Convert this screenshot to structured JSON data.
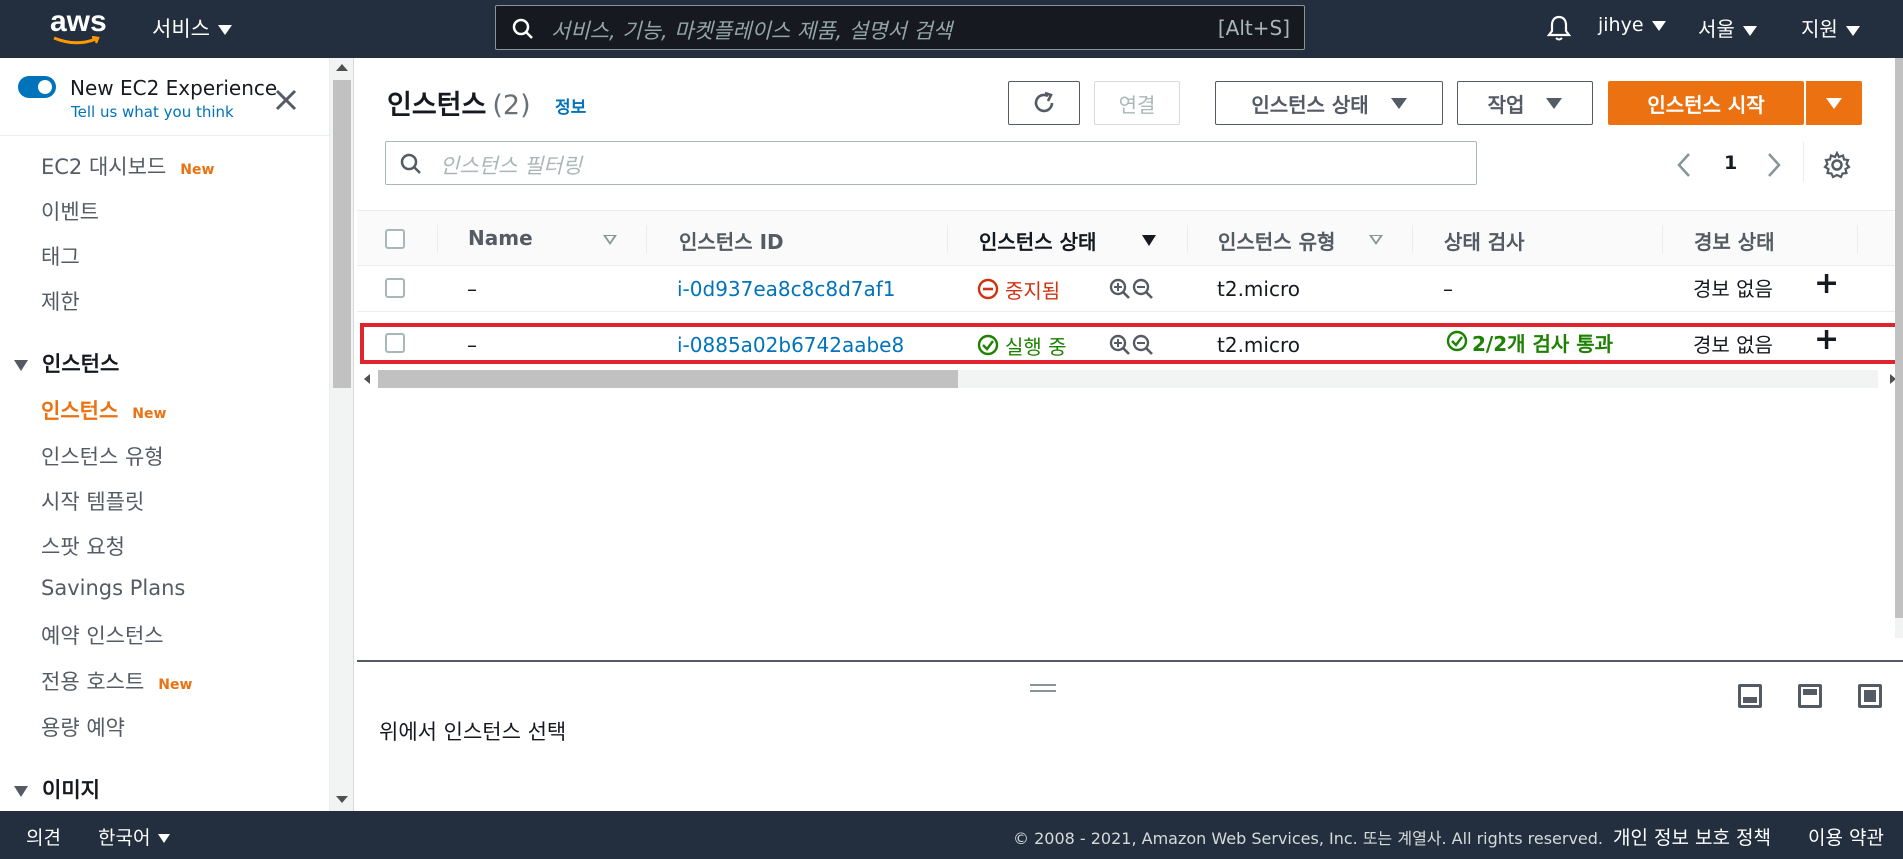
{
  "topbar": {
    "logo_text": "aws",
    "services_label": "서비스",
    "search_placeholder": "서비스, 기능, 마켓플레이스 제품, 설명서 검색",
    "search_shortcut": "[Alt+S]",
    "user": "jihye",
    "region": "서울",
    "support": "지원"
  },
  "sidebar": {
    "new_experience_label": "New EC2 Experience",
    "tell_us": "Tell us what you think",
    "items": [
      {
        "label": "EC2 대시보드",
        "badge": "New"
      },
      {
        "label": "이벤트"
      },
      {
        "label": "태그"
      },
      {
        "label": "제한"
      }
    ],
    "section_instances": "인스턴스",
    "instance_items": [
      {
        "label": "인스턴스",
        "badge": "New",
        "active": true
      },
      {
        "label": "인스턴스 유형"
      },
      {
        "label": "시작 템플릿"
      },
      {
        "label": "스팟 요청"
      },
      {
        "label": "Savings Plans"
      },
      {
        "label": "예약 인스턴스"
      },
      {
        "label": "전용 호스트",
        "badge": "New"
      },
      {
        "label": "용량 예약"
      }
    ],
    "section_images": "이미지"
  },
  "main": {
    "title": "인스턴스",
    "count": "(2)",
    "info_link": "정보",
    "buttons": {
      "connect": "연결",
      "instance_state": "인스턴스 상태",
      "actions": "작업",
      "launch": "인스턴스 시작"
    },
    "filter_placeholder": "인스턴스 필터링",
    "page": "1",
    "columns": [
      "Name",
      "인스턴스 ID",
      "인스턴스 상태",
      "인스턴스 유형",
      "상태 검사",
      "경보 상태"
    ],
    "rows": [
      {
        "name": "–",
        "instance_id": "i-0d937ea8c8c8d7af1",
        "state": "중지됨",
        "state_kind": "stopped",
        "type": "t2.micro",
        "status_check": "–",
        "alarm": "경보 없음",
        "selected": false
      },
      {
        "name": "–",
        "instance_id": "i-0885a02b6742aabe8",
        "state": "실행 중",
        "state_kind": "running",
        "type": "t2.micro",
        "status_check": "2/2개 검사 통과",
        "alarm": "경보 없음",
        "selected": true
      }
    ],
    "select_message": "위에서 인스턴스 선택"
  },
  "footer": {
    "feedback": "의견",
    "language": "한국어",
    "copyright": "© 2008 - 2021, Amazon Web Services, Inc. 또는 계열사. All rights reserved.",
    "privacy": "개인 정보 보호 정책",
    "terms": "이용 약관"
  },
  "colors": {
    "nav_bg": "#232f3e",
    "accent_orange": "#ec7211",
    "link_blue": "#0073bb",
    "stopped_red": "#d13212",
    "running_green": "#1d8102",
    "selection_red": "#e0242d"
  },
  "icons": [
    "search-icon",
    "bell-icon",
    "close-icon",
    "refresh-icon",
    "chevron-left-icon",
    "chevron-right-icon",
    "gear-icon",
    "stop-circle-icon",
    "check-circle-icon",
    "zoom-in-icon",
    "zoom-out-icon",
    "plus-icon"
  ]
}
